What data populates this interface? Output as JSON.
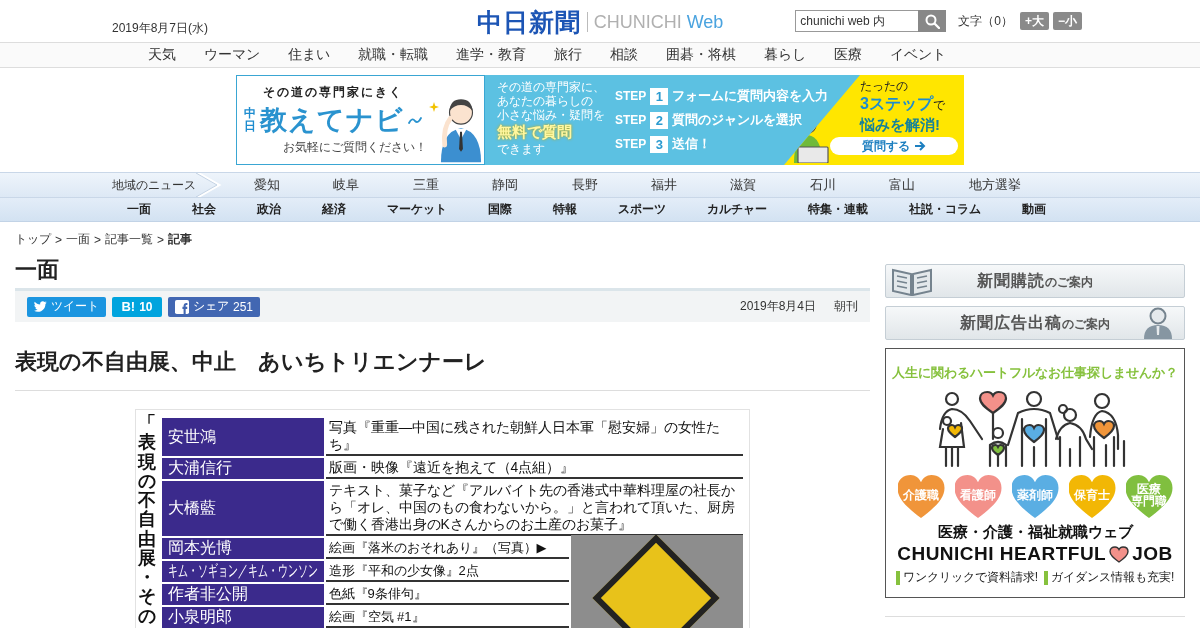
{
  "header": {
    "date": "2019年8月7日(水)",
    "logo": {
      "name": "中日新聞",
      "latin": "CHUNICHI",
      "suffix": "Web"
    },
    "search": {
      "value": "chunichi web 内"
    },
    "text_size": {
      "label": "文字（0）",
      "buttons": [
        "+大",
        "−小"
      ]
    }
  },
  "menu": [
    "天気",
    "ウーマン",
    "住まい",
    "就職・転職",
    "進学・教育",
    "旅行",
    "相談",
    "囲碁・将棋",
    "暮らし",
    "医療",
    "イベント"
  ],
  "promo_banner": {
    "tagline": "その道の専門家にきく",
    "brand_mark": "中日",
    "brand": "教えてナビ",
    "note": "お気軽にご質問ください！",
    "intro_lines": [
      "その道の専門家に、",
      "あなたの暮らしの",
      "小さな悩み・疑問を"
    ],
    "highlight": "無料で質問",
    "outro": "できます",
    "steps": [
      {
        "label": "STEP",
        "number": "1",
        "text": "フォームに質問内容を入力"
      },
      {
        "label": "STEP",
        "number": "2",
        "text": "質問のジャンルを選択"
      },
      {
        "label": "STEP",
        "number": "3",
        "text": "送信！"
      }
    ],
    "pitch_lead": "たったの",
    "pitch_headline": "**3ステップ**で",
    "pitch_emphasis": "悩みを解消!",
    "button": "質問する"
  },
  "region_nav": {
    "label": "地域のニュース",
    "items": [
      "愛知",
      "岐阜",
      "三重",
      "静岡",
      "長野",
      "福井",
      "滋賀",
      "石川",
      "富山",
      "地方選挙"
    ]
  },
  "category_nav": [
    "一面",
    "社会",
    "政治",
    "経済",
    "マーケット",
    "国際",
    "特報",
    "スポーツ",
    "カルチャー",
    "特集・連載",
    "社説・コラム",
    "動画"
  ],
  "breadcrumb": [
    {
      "label": "トップ",
      "current": false
    },
    {
      "prefix": ">",
      "label": "一面",
      "current": false
    },
    {
      "prefix": ">",
      "label": "記事一覧",
      "current": false
    },
    {
      "prefix": ">",
      "label": "記事",
      "current": true
    }
  ],
  "section": {
    "title": "一面",
    "share_buttons": [
      {
        "kind": "twitter",
        "label": "ツイート"
      },
      {
        "kind": "hatena",
        "label": "B!",
        "count": "10"
      },
      {
        "kind": "facebook",
        "label": "シェア",
        "count": "251"
      }
    ],
    "date": "2019年8月4日",
    "edition": "朝刊"
  },
  "article": {
    "headline": "表現の不自由展、中止　あいちトリエンナーレ",
    "figure": {
      "title": "「表現の不自由展・その",
      "rows": [
        {
          "artist": "安世鴻",
          "work": "写真『重重―中国に残された朝鮮人日本軍「慰安婦」の女性たち』"
        },
        {
          "artist": "大浦信行",
          "work": "版画・映像『遠近を抱えて（4点組）』"
        },
        {
          "artist": "大橋藍",
          "work": "テキスト、菓子など『アルバイト先の香港式中華料理屋の社長から「オレ、中国のもの食わないから。」と言われて頂いた、厨房で働く香港出身のKさんからのお土産のお菓子』"
        },
        {
          "artist": "岡本光博",
          "work": "絵画『落米のおそれあり』（写真）▶"
        },
        {
          "artist": "キム・ソギョン／キム・ウンソン",
          "work": "造形『平和の少女像』2点"
        },
        {
          "artist": "作者非公開",
          "work": "色紙『9条俳句』"
        },
        {
          "artist": "小泉明郎",
          "work": "絵画『空気 #1』"
        }
      ]
    }
  },
  "sidebar": {
    "links": [
      {
        "kind": "subscribe",
        "title": "新聞購読",
        "suffix": "のご案内"
      },
      {
        "kind": "advertise",
        "title": "新聞広告出稿",
        "suffix": "のご案内"
      }
    ],
    "ad": {
      "tagline": "人生に関わるハートフルなお仕事探しませんか？",
      "categories": [
        {
          "lines": [
            "介護職"
          ],
          "color": "#f0953a"
        },
        {
          "lines": [
            "看護師"
          ],
          "color": "#f3918a"
        },
        {
          "lines": [
            "薬剤師"
          ],
          "color": "#5aaee3"
        },
        {
          "lines": [
            "保育士"
          ],
          "color": "#f2b705"
        },
        {
          "lines": [
            "医療",
            "専門職"
          ],
          "color": "#80bf3f"
        }
      ],
      "subtitle": "医療・介護・福祉就職ウェブ",
      "brand": "CHUNICHI HEARTFUL",
      "brand_end": "JOB",
      "features": [
        "ワンクリックで資料請求!",
        "ガイダンス情報も充実!"
      ]
    }
  }
}
